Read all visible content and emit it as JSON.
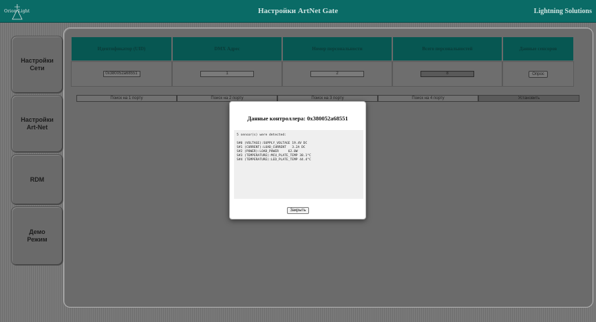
{
  "header": {
    "logo_text": "Orion Light",
    "title": "Настройки ArtNet Gate",
    "brand": "Lightning Solutions"
  },
  "sidebar": {
    "items": [
      {
        "label": "Настройки Сети"
      },
      {
        "label": "Настройки Art-Net"
      },
      {
        "label": "RDM"
      },
      {
        "label": "Демо Режим"
      }
    ]
  },
  "table": {
    "headers": [
      "Идентификатор (UID)",
      "DMX Адрес",
      "Номер персональности",
      "Всего персональностей",
      "Данные сенсоров"
    ],
    "row": {
      "uid": "0x380052a68551",
      "dmx_address": "1",
      "personality_number": "2",
      "personality_total": "8",
      "sensor_button": "Опрос"
    }
  },
  "search": {
    "buttons": [
      "Поиск на 1 порту",
      "Поиск на 2 порту",
      "Поиск на 3 порту",
      "Поиск на 4 порту"
    ],
    "set_button": "Установить"
  },
  "modal": {
    "title": "Данные контроллера: 0x380052a68551",
    "summary": "5 sensor(s) were detected:",
    "lines": [
      "S#0 (VOLTAGE):SUPPLY_VOLTAGE 19.4V DC",
      "S#1 (CURRENT):LOAD_CURRENT   3.2A DC",
      "S#2 (POWER):LOAD_POWER     62.0W",
      "S#3 (TEMPERATURE):MCU_PLATE_TEMP 38.1°C",
      "S#4 (TEMPERATURE):LED_PLATE_TEMP 44.4°C"
    ],
    "close_label": "Закрыть"
  }
}
